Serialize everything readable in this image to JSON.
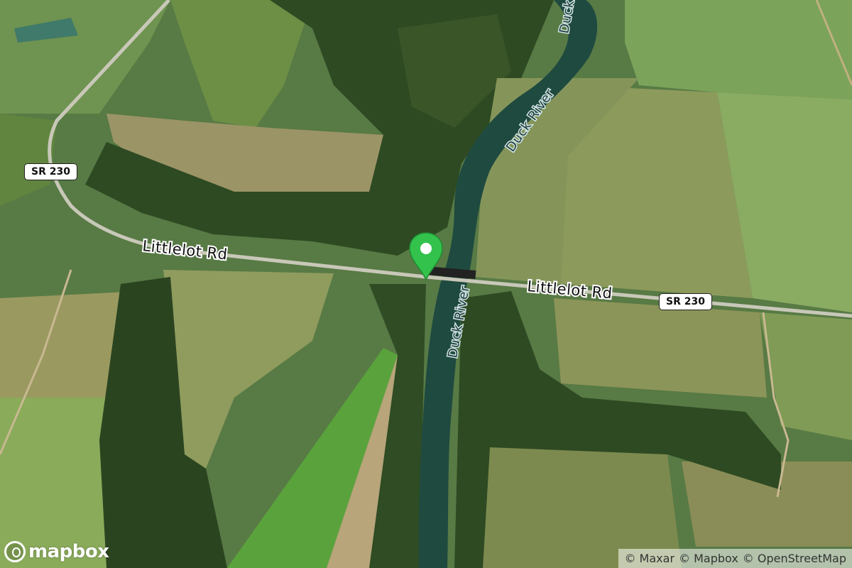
{
  "map": {
    "type": "satellite",
    "roads": [
      {
        "name": "Littlelot Rd"
      },
      {
        "name": "Littlelot Rd"
      }
    ],
    "route_shields": [
      "SR 230",
      "SR 230"
    ],
    "water_labels": [
      "Duck River",
      "Duck River",
      "Duck"
    ],
    "marker": {
      "color": "#33c24b",
      "icon": "map-pin-icon"
    },
    "logo": {
      "text": "mapbox",
      "icon": "mapbox-logo-icon"
    },
    "attribution": [
      "© Maxar",
      "© Mapbox",
      "© OpenStreetMap"
    ]
  }
}
